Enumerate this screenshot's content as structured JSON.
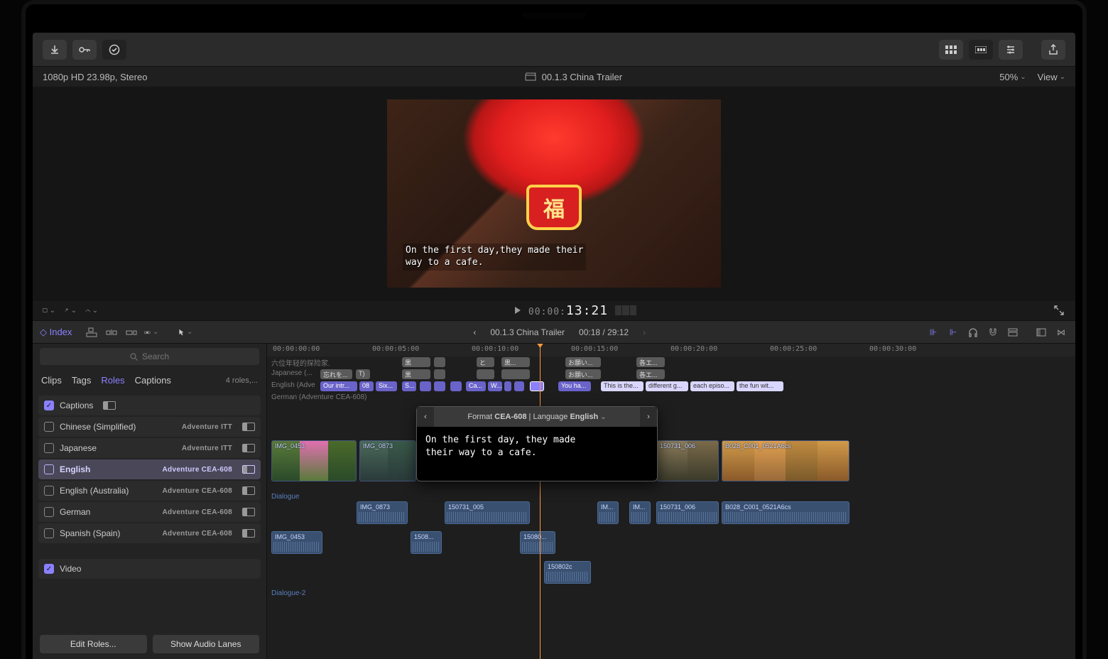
{
  "header": {
    "format_text": "1080p HD 23.98p, Stereo",
    "project_name": "00.1.3 China Trailer",
    "zoom_label": "50%",
    "view_label": "View"
  },
  "viewer": {
    "caption_line1": "On the first day,they made their",
    "caption_line2": "way to a cafe.",
    "fu_glyph": "福"
  },
  "transport": {
    "timecode_dim": "00:00:",
    "timecode_bold": "13:21"
  },
  "row2": {
    "index_label": "Index",
    "title": "00.1.3 China Trailer",
    "time_text": "00:18 / 29:12"
  },
  "search": {
    "placeholder": "Search"
  },
  "tabs": {
    "clips": "Clips",
    "tags": "Tags",
    "roles": "Roles",
    "captions": "Captions",
    "meta": "4 roles,..."
  },
  "roles": {
    "captions_header": "Captions",
    "chinese": {
      "label": "Chinese (Simplified)",
      "sub": "Adventure ITT"
    },
    "japanese": {
      "label": "Japanese",
      "sub": "Adventure ITT"
    },
    "english": {
      "label": "English",
      "sub": "Adventure CEA-608"
    },
    "english_au": {
      "label": "English (Australia)",
      "sub": "Adventure CEA-608"
    },
    "german": {
      "label": "German",
      "sub": "Adventure CEA-608"
    },
    "spanish": {
      "label": "Spanish (Spain)",
      "sub": "Adventure CEA-608"
    },
    "video": "Video"
  },
  "buttons": {
    "edit_roles": "Edit Roles...",
    "show_audio_lanes": "Show Audio Lanes"
  },
  "ruler": {
    "t0": "00:00:00:00",
    "t5": "00:00:05:00",
    "t10": "00:00:10:00",
    "t15": "00:00:15:00",
    "t20": "00:00:20:00",
    "t25": "00:00:25:00",
    "t30": "00:00:30:00"
  },
  "caption_lanes": {
    "chinese_label": "六位年轻的探险家.",
    "japanese_label": "Japanese (...",
    "english_label": "English (Adve",
    "german_label": "German (Adventure CEA-608)",
    "jp": {
      "c1": "忘れを...",
      "c2": "T)"
    },
    "en": {
      "c1": "Our intr...",
      "c2": "Six...",
      "c3": "S...",
      "c4": "Ca...",
      "c5": "W...",
      "you_ha": "You ha...",
      "this_is": "This is the...",
      "diff": "different g...",
      "each": "each episo...",
      "fun": "the fun wit..."
    },
    "chinese_clips": {
      "a": "黒",
      "b": "と",
      "c": "黒...",
      "d": "お願い...",
      "e": "各エ...",
      "f": "お願い...",
      "g": "各エ..."
    }
  },
  "video_clips": {
    "a": "IMG_0453",
    "b": "IMG_0873",
    "c": "150731_006",
    "d": "B028_C001_0521A6cs"
  },
  "audio": {
    "dialogue": "Dialogue",
    "dialogue2": "Dialogue-2",
    "c1": "IMG_0873",
    "c2": "150731_005",
    "c3": "IM...",
    "c4": "IM...",
    "c5": "150731_006",
    "c6": "B028_C001_0521A6cs",
    "d1": "IMG_0453",
    "d2": "1508...",
    "d3": "15080...",
    "d4": "150802c"
  },
  "editor": {
    "format_label": "Format ",
    "format_value": "CEA-608",
    "language_label": " | Language ",
    "language_value": "English",
    "line1": "On the first day, they made",
    "line2": "their way to a cafe."
  }
}
